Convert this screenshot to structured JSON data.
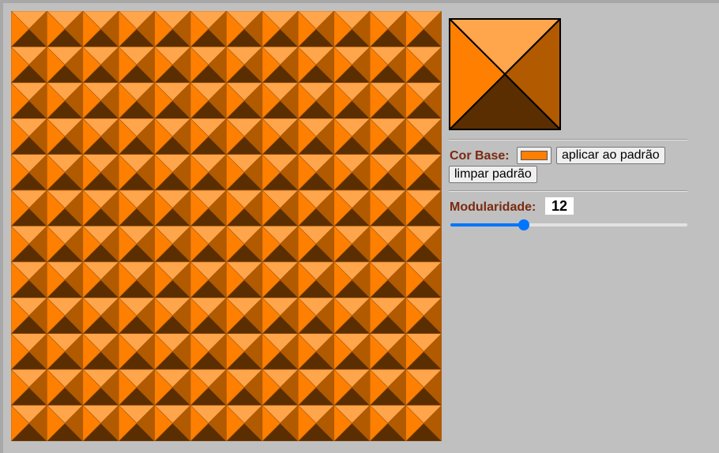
{
  "pattern": {
    "tiles_per_side": 12,
    "colors": {
      "top": "#ffa54c",
      "left": "#ff7f00",
      "right": "#b25a00",
      "bottom": "#5a2e00",
      "outline": "#000000"
    }
  },
  "controls": {
    "base_color_label": "Cor Base:",
    "base_color_value": "#ff7f00",
    "apply_button": "aplicar ao padrão",
    "clear_button": "limpar padrão",
    "modularity_label": "Modularidade:",
    "modularity_value": "12",
    "slider_fraction": 0.31
  }
}
